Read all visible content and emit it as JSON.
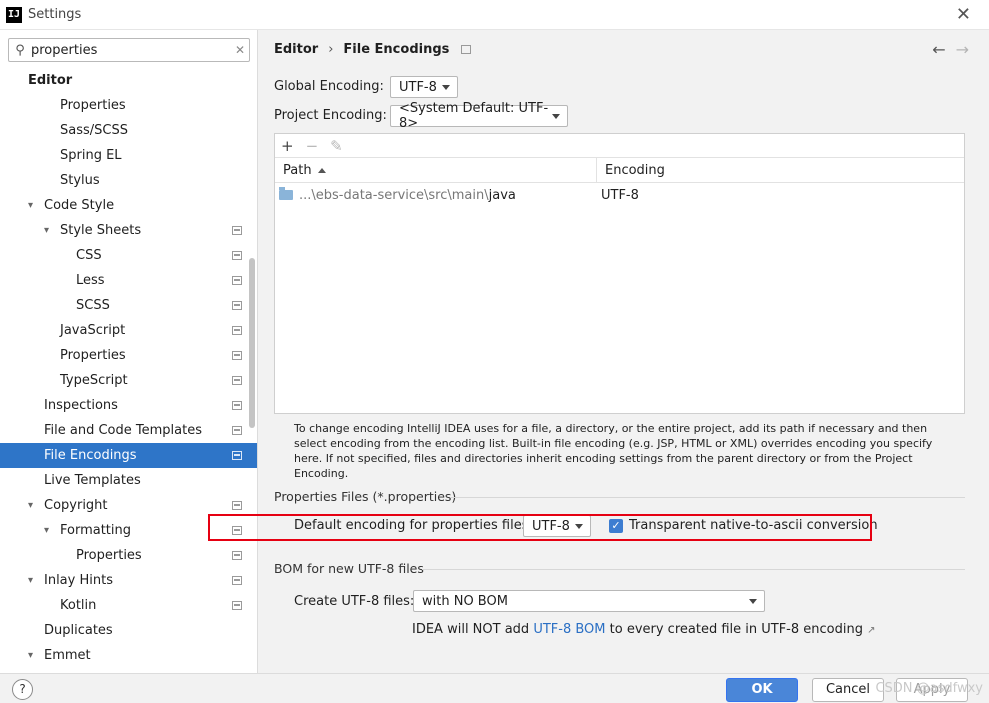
{
  "window": {
    "title": "Settings",
    "app_icon": "IJ",
    "close_icon": "close-icon"
  },
  "search": {
    "value": "properties",
    "icon": "search-icon",
    "clear_icon": "clear-icon"
  },
  "sidebar": {
    "items": [
      {
        "label": "Editor",
        "level": 0,
        "header": true
      },
      {
        "label": "Properties",
        "level": 2
      },
      {
        "label": "Sass/SCSS",
        "level": 2
      },
      {
        "label": "Spring EL",
        "level": 2
      },
      {
        "label": "Stylus",
        "level": 2
      },
      {
        "label": "Code Style",
        "level": 1,
        "caret": true
      },
      {
        "label": "Style Sheets",
        "level": 2,
        "caret": true,
        "proj": true
      },
      {
        "label": "CSS",
        "level": 3,
        "proj": true
      },
      {
        "label": "Less",
        "level": 3,
        "proj": true
      },
      {
        "label": "SCSS",
        "level": 3,
        "proj": true
      },
      {
        "label": "JavaScript",
        "level": 2,
        "proj": true
      },
      {
        "label": "Properties",
        "level": 2,
        "proj": true
      },
      {
        "label": "TypeScript",
        "level": 2,
        "proj": true
      },
      {
        "label": "Inspections",
        "level": 1,
        "proj": true
      },
      {
        "label": "File and Code Templates",
        "level": 1,
        "proj": true
      },
      {
        "label": "File Encodings",
        "level": 1,
        "proj": true,
        "selected": true
      },
      {
        "label": "Live Templates",
        "level": 1
      },
      {
        "label": "Copyright",
        "level": 1,
        "caret": true,
        "proj": true
      },
      {
        "label": "Formatting",
        "level": 2,
        "caret": true,
        "proj": true
      },
      {
        "label": "Properties",
        "level": 3,
        "proj": true
      },
      {
        "label": "Inlay Hints",
        "level": 1,
        "caret": true,
        "proj": true
      },
      {
        "label": "Kotlin",
        "level": 2,
        "proj": true
      },
      {
        "label": "Duplicates",
        "level": 1
      },
      {
        "label": "Emmet",
        "level": 1,
        "caret": true
      }
    ]
  },
  "breadcrumb": {
    "parent": "Editor",
    "separator": "›",
    "current": "File Encodings"
  },
  "global_encoding": {
    "label": "Global Encoding:",
    "value": "UTF-8"
  },
  "project_encoding": {
    "label": "Project Encoding:",
    "value": "<System Default: UTF-8>"
  },
  "table": {
    "toolbar": {
      "add": "+",
      "remove": "−",
      "edit": "✎"
    },
    "columns": [
      "Path",
      "Encoding"
    ],
    "rows": [
      {
        "path_prefix": "...\\ebs-data-service\\src\\main\\",
        "path_last": "java",
        "encoding": "UTF-8"
      }
    ]
  },
  "help_text": "To change encoding IntelliJ IDEA uses for a file, a directory, or the entire project, add its path if necessary and then select encoding from the encoding list. Built-in file encoding (e.g. JSP, HTML or XML) overrides encoding you specify here. If not specified, files and directories inherit encoding settings from the parent directory or from the Project Encoding.",
  "properties_section": {
    "title": "Properties Files (*.properties)",
    "default_label": "Default encoding for properties files:",
    "default_value": "UTF-8",
    "native_to_ascii_label": "Transparent native-to-ascii conversion",
    "native_to_ascii_checked": true
  },
  "bom_section": {
    "title": "BOM for new UTF-8 files",
    "create_label": "Create UTF-8 files:",
    "create_value": "with NO BOM",
    "note_before": "IDEA will NOT add ",
    "note_link": "UTF-8 BOM",
    "note_after": " to every created file in UTF-8 encoding"
  },
  "buttons": {
    "help": "?",
    "ok": "OK",
    "cancel": "Cancel",
    "apply": "Apply"
  },
  "watermark": "CSDN @asdfwxy",
  "colors": {
    "selection": "#2e75c8",
    "highlight_box": "#e60012",
    "link": "#2a6fc4",
    "ok_button": "#4a86d8"
  }
}
